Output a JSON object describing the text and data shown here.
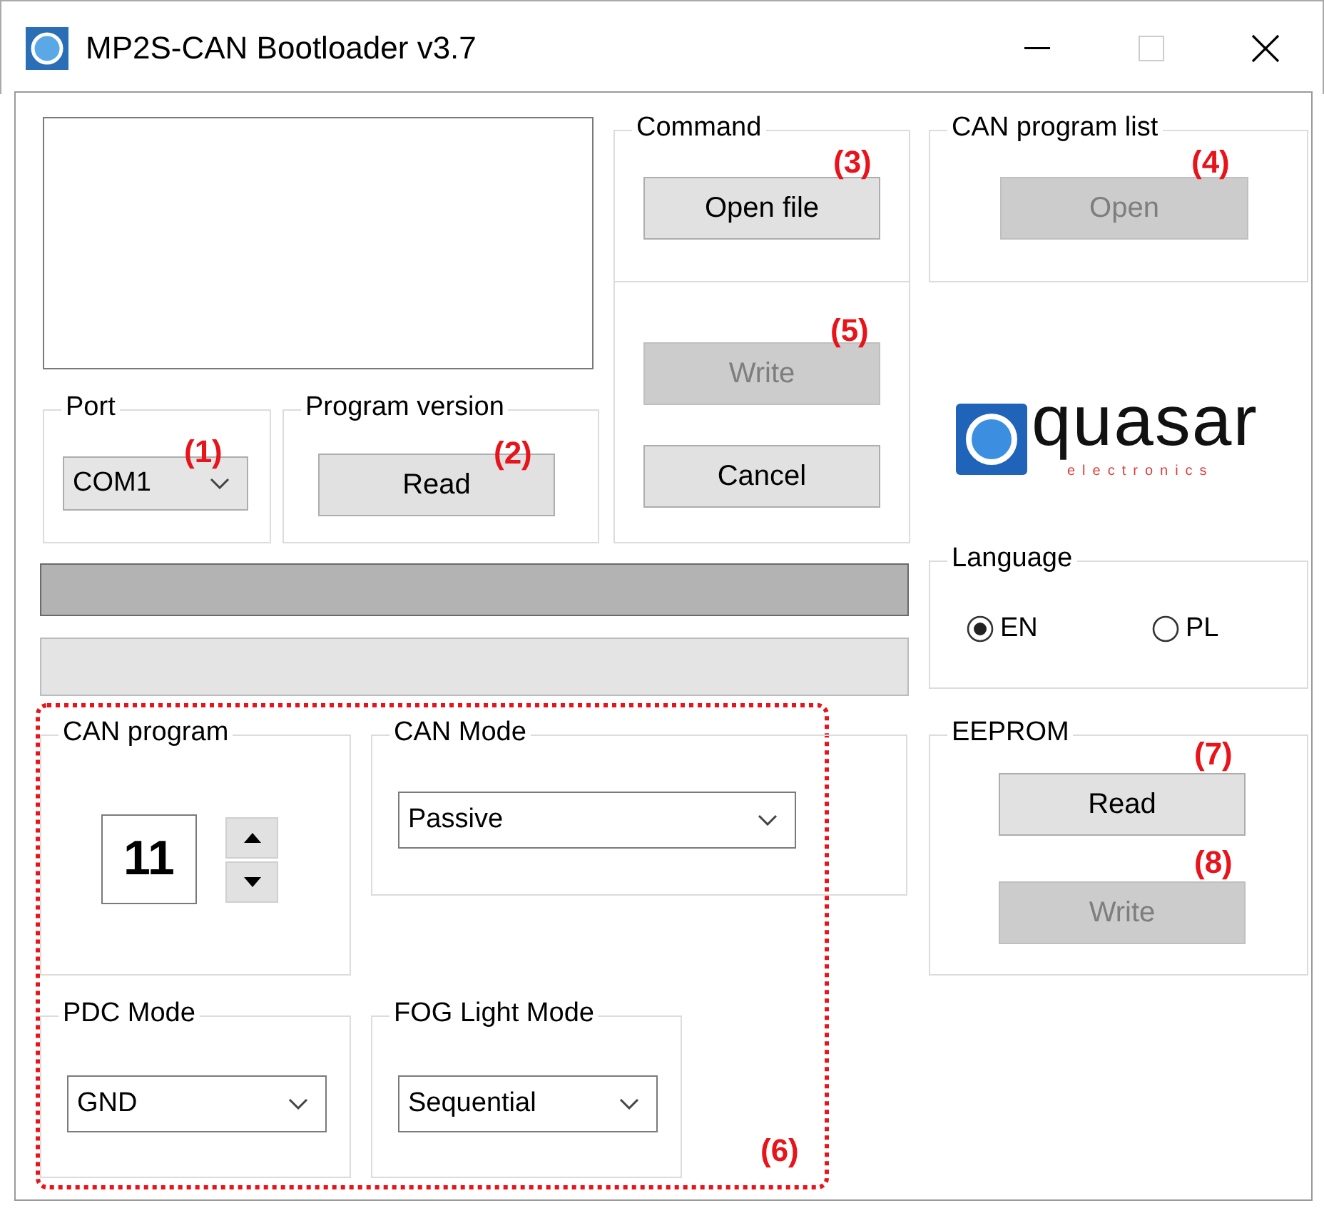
{
  "window": {
    "title": "MP2S-CAN Bootloader v3.7"
  },
  "port": {
    "label": "Port",
    "value": "COM1",
    "annotation": "(1)"
  },
  "program_version": {
    "label": "Program version",
    "button": {
      "label": "Read",
      "disabled": false
    },
    "annotation": "(2)"
  },
  "command": {
    "label": "Command",
    "button": {
      "label": "Open file",
      "disabled": false
    },
    "annotation": "(3)"
  },
  "can_program_list": {
    "label": "CAN program list",
    "button": {
      "label": "Open",
      "disabled": true
    },
    "annotation": "(4)"
  },
  "write_panel": {
    "buttons": [
      {
        "label": "Write",
        "disabled": true
      },
      {
        "label": "Cancel",
        "disabled": false
      }
    ],
    "annotation": "(5)"
  },
  "logo": {
    "name": "quasar",
    "tagline": "electronics"
  },
  "language": {
    "label": "Language",
    "options": [
      {
        "label": "EN",
        "selected": true
      },
      {
        "label": "PL",
        "selected": false
      }
    ]
  },
  "eeprom": {
    "label": "EEPROM",
    "buttons": [
      {
        "label": "Read",
        "disabled": false,
        "annotation": "(7)"
      },
      {
        "label": "Write",
        "disabled": true,
        "annotation": "(8)"
      }
    ]
  },
  "settings": {
    "annotation": "(6)",
    "can_program": {
      "label": "CAN program",
      "value": "11"
    },
    "can_mode": {
      "label": "CAN Mode",
      "value": "Passive"
    },
    "pdc_mode": {
      "label": "PDC Mode",
      "value": "GND"
    },
    "fog_light_mode": {
      "label": "FOG Light Mode",
      "value": "Sequential"
    }
  }
}
